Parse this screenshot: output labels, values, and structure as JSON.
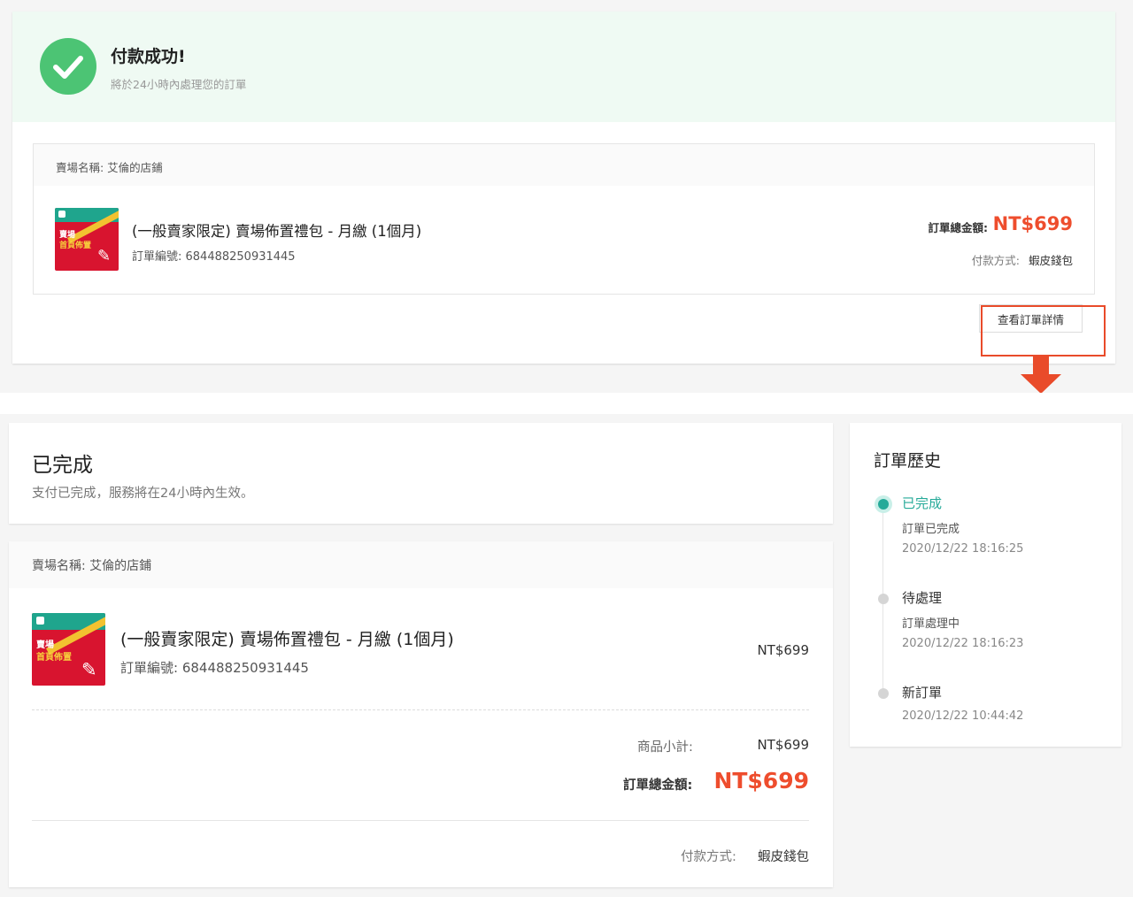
{
  "colors": {
    "accent": "#ee4d2d",
    "success": "#4cc474",
    "timeline_active": "#26aa99",
    "banner_bg": "#effaf3"
  },
  "top": {
    "title": "付款成功!",
    "subtitle": "將於24小時內處理您的訂單",
    "shop_label": "賣場名稱: 艾倫的店鋪",
    "product": {
      "thumb_line1": "賣場",
      "thumb_line2": "首頁佈置",
      "name": "(一般賣家限定) 賣場佈置禮包 - 月繳 (1個月)",
      "order_no": "訂單編號: 684488250931445"
    },
    "total_label": "訂單總金額:",
    "total_value": "NT$699",
    "pay_label": "付款方式:",
    "pay_value": "蝦皮錢包",
    "view_detail_button": "查看訂單詳情"
  },
  "status": {
    "title": "已完成",
    "desc": "支付已完成，服務將在24小時內生效。"
  },
  "detail": {
    "shop_label": "賣場名稱: 艾倫的店鋪",
    "product": {
      "thumb_line1": "賣場",
      "thumb_line2": "首頁佈置",
      "name": "(一般賣家限定) 賣場佈置禮包 - 月繳 (1個月)",
      "order_no": "訂單編號: 684488250931445",
      "price": "NT$699"
    },
    "subtotal_label": "商品小計:",
    "subtotal_value": "NT$699",
    "grand_label": "訂單總金額:",
    "grand_value": "NT$699",
    "pay_label": "付款方式:",
    "pay_value": "蝦皮錢包"
  },
  "history": {
    "title": "訂單歷史",
    "events": [
      {
        "title": "已完成",
        "sub": "訂單已完成",
        "time": "2020/12/22 18:16:25"
      },
      {
        "title": "待處理",
        "sub": "訂單處理中",
        "time": "2020/12/22 18:16:23"
      },
      {
        "title": "新訂單",
        "time": "2020/12/22 10:44:42"
      }
    ]
  }
}
